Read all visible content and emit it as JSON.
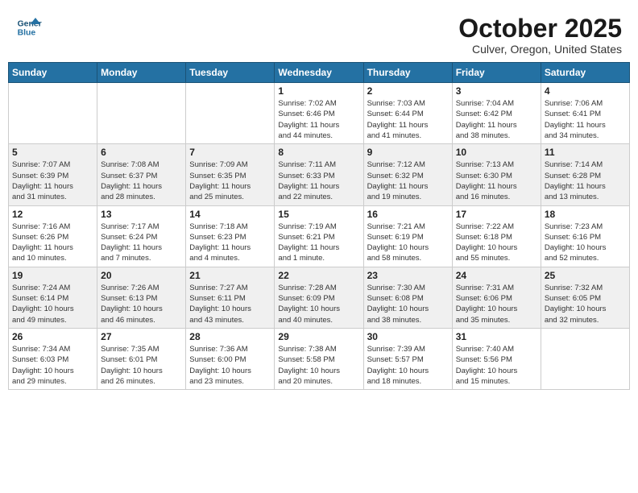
{
  "header": {
    "logo_line1": "General",
    "logo_line2": "Blue",
    "month": "October 2025",
    "location": "Culver, Oregon, United States"
  },
  "weekdays": [
    "Sunday",
    "Monday",
    "Tuesday",
    "Wednesday",
    "Thursday",
    "Friday",
    "Saturday"
  ],
  "weeks": [
    [
      {
        "day": "",
        "info": ""
      },
      {
        "day": "",
        "info": ""
      },
      {
        "day": "",
        "info": ""
      },
      {
        "day": "1",
        "info": "Sunrise: 7:02 AM\nSunset: 6:46 PM\nDaylight: 11 hours\nand 44 minutes."
      },
      {
        "day": "2",
        "info": "Sunrise: 7:03 AM\nSunset: 6:44 PM\nDaylight: 11 hours\nand 41 minutes."
      },
      {
        "day": "3",
        "info": "Sunrise: 7:04 AM\nSunset: 6:42 PM\nDaylight: 11 hours\nand 38 minutes."
      },
      {
        "day": "4",
        "info": "Sunrise: 7:06 AM\nSunset: 6:41 PM\nDaylight: 11 hours\nand 34 minutes."
      }
    ],
    [
      {
        "day": "5",
        "info": "Sunrise: 7:07 AM\nSunset: 6:39 PM\nDaylight: 11 hours\nand 31 minutes."
      },
      {
        "day": "6",
        "info": "Sunrise: 7:08 AM\nSunset: 6:37 PM\nDaylight: 11 hours\nand 28 minutes."
      },
      {
        "day": "7",
        "info": "Sunrise: 7:09 AM\nSunset: 6:35 PM\nDaylight: 11 hours\nand 25 minutes."
      },
      {
        "day": "8",
        "info": "Sunrise: 7:11 AM\nSunset: 6:33 PM\nDaylight: 11 hours\nand 22 minutes."
      },
      {
        "day": "9",
        "info": "Sunrise: 7:12 AM\nSunset: 6:32 PM\nDaylight: 11 hours\nand 19 minutes."
      },
      {
        "day": "10",
        "info": "Sunrise: 7:13 AM\nSunset: 6:30 PM\nDaylight: 11 hours\nand 16 minutes."
      },
      {
        "day": "11",
        "info": "Sunrise: 7:14 AM\nSunset: 6:28 PM\nDaylight: 11 hours\nand 13 minutes."
      }
    ],
    [
      {
        "day": "12",
        "info": "Sunrise: 7:16 AM\nSunset: 6:26 PM\nDaylight: 11 hours\nand 10 minutes."
      },
      {
        "day": "13",
        "info": "Sunrise: 7:17 AM\nSunset: 6:24 PM\nDaylight: 11 hours\nand 7 minutes."
      },
      {
        "day": "14",
        "info": "Sunrise: 7:18 AM\nSunset: 6:23 PM\nDaylight: 11 hours\nand 4 minutes."
      },
      {
        "day": "15",
        "info": "Sunrise: 7:19 AM\nSunset: 6:21 PM\nDaylight: 11 hours\nand 1 minute."
      },
      {
        "day": "16",
        "info": "Sunrise: 7:21 AM\nSunset: 6:19 PM\nDaylight: 10 hours\nand 58 minutes."
      },
      {
        "day": "17",
        "info": "Sunrise: 7:22 AM\nSunset: 6:18 PM\nDaylight: 10 hours\nand 55 minutes."
      },
      {
        "day": "18",
        "info": "Sunrise: 7:23 AM\nSunset: 6:16 PM\nDaylight: 10 hours\nand 52 minutes."
      }
    ],
    [
      {
        "day": "19",
        "info": "Sunrise: 7:24 AM\nSunset: 6:14 PM\nDaylight: 10 hours\nand 49 minutes."
      },
      {
        "day": "20",
        "info": "Sunrise: 7:26 AM\nSunset: 6:13 PM\nDaylight: 10 hours\nand 46 minutes."
      },
      {
        "day": "21",
        "info": "Sunrise: 7:27 AM\nSunset: 6:11 PM\nDaylight: 10 hours\nand 43 minutes."
      },
      {
        "day": "22",
        "info": "Sunrise: 7:28 AM\nSunset: 6:09 PM\nDaylight: 10 hours\nand 40 minutes."
      },
      {
        "day": "23",
        "info": "Sunrise: 7:30 AM\nSunset: 6:08 PM\nDaylight: 10 hours\nand 38 minutes."
      },
      {
        "day": "24",
        "info": "Sunrise: 7:31 AM\nSunset: 6:06 PM\nDaylight: 10 hours\nand 35 minutes."
      },
      {
        "day": "25",
        "info": "Sunrise: 7:32 AM\nSunset: 6:05 PM\nDaylight: 10 hours\nand 32 minutes."
      }
    ],
    [
      {
        "day": "26",
        "info": "Sunrise: 7:34 AM\nSunset: 6:03 PM\nDaylight: 10 hours\nand 29 minutes."
      },
      {
        "day": "27",
        "info": "Sunrise: 7:35 AM\nSunset: 6:01 PM\nDaylight: 10 hours\nand 26 minutes."
      },
      {
        "day": "28",
        "info": "Sunrise: 7:36 AM\nSunset: 6:00 PM\nDaylight: 10 hours\nand 23 minutes."
      },
      {
        "day": "29",
        "info": "Sunrise: 7:38 AM\nSunset: 5:58 PM\nDaylight: 10 hours\nand 20 minutes."
      },
      {
        "day": "30",
        "info": "Sunrise: 7:39 AM\nSunset: 5:57 PM\nDaylight: 10 hours\nand 18 minutes."
      },
      {
        "day": "31",
        "info": "Sunrise: 7:40 AM\nSunset: 5:56 PM\nDaylight: 10 hours\nand 15 minutes."
      },
      {
        "day": "",
        "info": ""
      }
    ]
  ]
}
